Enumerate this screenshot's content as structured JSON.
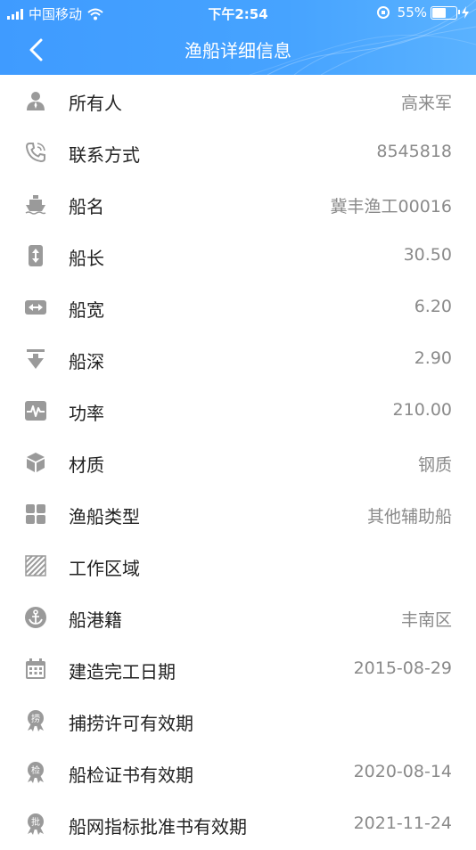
{
  "status_bar": {
    "carrier": "中国移动",
    "time": "下午2:54",
    "battery": "55%"
  },
  "nav": {
    "title": "渔船详细信息"
  },
  "rows": [
    {
      "icon": "person-icon",
      "label": "所有人",
      "value": "高来军"
    },
    {
      "icon": "phone-icon",
      "label": "联系方式",
      "value": "8545818"
    },
    {
      "icon": "ship-icon",
      "label": "船名",
      "value": "冀丰渔工00016"
    },
    {
      "icon": "vertical-arrows-icon",
      "label": "船长",
      "value": "30.50"
    },
    {
      "icon": "horizontal-arrows-icon",
      "label": "船宽",
      "value": "6.20"
    },
    {
      "icon": "depth-arrow-icon",
      "label": "船深",
      "value": "2.90"
    },
    {
      "icon": "pulse-icon",
      "label": "功率",
      "value": "210.00"
    },
    {
      "icon": "cube-icon",
      "label": "材质",
      "value": "钢质"
    },
    {
      "icon": "grid-icon",
      "label": "渔船类型",
      "value": "其他辅助船"
    },
    {
      "icon": "hatched-area-icon",
      "label": "工作区域",
      "value": ""
    },
    {
      "icon": "anchor-icon",
      "label": "船港籍",
      "value": "丰南区"
    },
    {
      "icon": "calendar-icon",
      "label": "建造完工日期",
      "value": "2015-08-29"
    },
    {
      "icon": "badge-icon",
      "badge_text": "捞",
      "label": "捕捞许可有效期",
      "value": ""
    },
    {
      "icon": "badge-icon",
      "badge_text": "检",
      "label": "船检证书有效期",
      "value": "2020-08-14"
    },
    {
      "icon": "badge-icon",
      "badge_text": "批",
      "label": "船网指标批准书有效期",
      "value": "2021-11-24"
    }
  ]
}
